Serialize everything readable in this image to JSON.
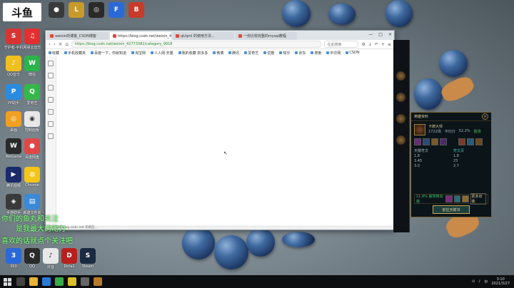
{
  "desktop": {
    "logo": "斗鱼",
    "icons": [
      {
        "label": "守护者-手机",
        "color": "#d83434",
        "glyph": "S"
      },
      {
        "label": "网易云音乐",
        "color": "#e23030",
        "glyph": "♫"
      },
      {
        "label": "QQ音乐",
        "color": "#f0c020",
        "glyph": "♪"
      },
      {
        "label": "微信",
        "color": "#2bb44b",
        "glyph": "W"
      },
      {
        "label": "PP助手",
        "color": "#2a8be0",
        "glyph": "P"
      },
      {
        "label": "爱奇艺",
        "color": "#34b84a",
        "glyph": "Q"
      },
      {
        "label": "桌面",
        "color": "#f0a020",
        "glyph": "◎"
      },
      {
        "label": "控制面板",
        "color": "#e8e8e8",
        "glyph": "◉"
      },
      {
        "label": "WeGame",
        "color": "#2a2a2a",
        "glyph": "W"
      },
      {
        "label": "百度网盘",
        "color": "#e04848",
        "glyph": "●"
      },
      {
        "label": "腾讯视频",
        "color": "#1a2a6a",
        "glyph": "▶"
      },
      {
        "label": "Chrome",
        "color": "#f5c518",
        "glyph": "◍"
      },
      {
        "label": "手游助手",
        "color": "#3a3a3a",
        "glyph": "◈"
      },
      {
        "label": "新建文件夹",
        "color": "#3a8ad8",
        "glyph": "▤"
      },
      {
        "label": "360",
        "color": "#2a6ad8",
        "glyph": "3"
      },
      {
        "label": "QQ",
        "color": "#2a2a2a",
        "glyph": "Q"
      },
      {
        "label": "抖音",
        "color": "#e8e8e8",
        "glyph": "♪"
      },
      {
        "label": "Dota2",
        "color": "#b82020",
        "glyph": "D"
      },
      {
        "label": "Steam",
        "color": "#1a2a40",
        "glyph": "S"
      }
    ],
    "top_icons": [
      {
        "label": "",
        "color": "#3a3a3a",
        "glyph": "●"
      },
      {
        "label": "",
        "color": "#c89a2a",
        "glyph": "L"
      },
      {
        "label": "",
        "color": "#2a2a2a",
        "glyph": "◎"
      },
      {
        "label": "",
        "color": "#2a6ad8",
        "glyph": "F"
      },
      {
        "label": "",
        "color": "#c83a2a",
        "glyph": "B"
      }
    ]
  },
  "browser": {
    "tabs": [
      {
        "label": "weixin的博客_CSDN博客",
        "active": false
      },
      {
        "label": "https://blog.csdn.net/weixin_42",
        "active": true
      },
      {
        "label": "qt/qml 的使用方法...",
        "active": false
      },
      {
        "label": "一份比较完整的mysql教程",
        "active": false
      }
    ],
    "window_controls": [
      "—",
      "□",
      "×"
    ],
    "url": "https://blog.csdn.net/weixin_42773382/category_9918",
    "search_placeholder": "在此搜索",
    "bookmarks": [
      "收藏",
      "手机收藏夹",
      "百度一下，你就知道",
      "淘宝网",
      "人人网·天猫",
      "我的收藏 拼多多",
      "微博",
      "腾讯",
      "爱奇艺",
      "优酷",
      "知乎",
      "京东",
      "搜索",
      "中华网",
      "CSDN"
    ],
    "status_text": "正在等待 blog.csdn.net 的响应..."
  },
  "game_panel": {
    "title": "英雄资料",
    "champion": "卡牌大师",
    "stats": [
      "1722场",
      "平均分",
      "52.2%",
      "胜场"
    ],
    "left_col": [
      "天赋符文",
      "1.8",
      "3.45",
      "3.0"
    ],
    "right_col": [
      "符文页",
      "1.8",
      "23",
      "2.7"
    ],
    "bottom_text": "11.6% 最常用出装",
    "more_label": "更多出装",
    "button": "前往天赋书"
  },
  "overlay_text": [
    "你们的鱼丸和关注",
    "是我最大的动力",
    "喜欢的话就点个关注吧"
  ],
  "taskbar": {
    "clock_time": "3:10",
    "clock_date": "2021/3/27",
    "lang": "中"
  }
}
